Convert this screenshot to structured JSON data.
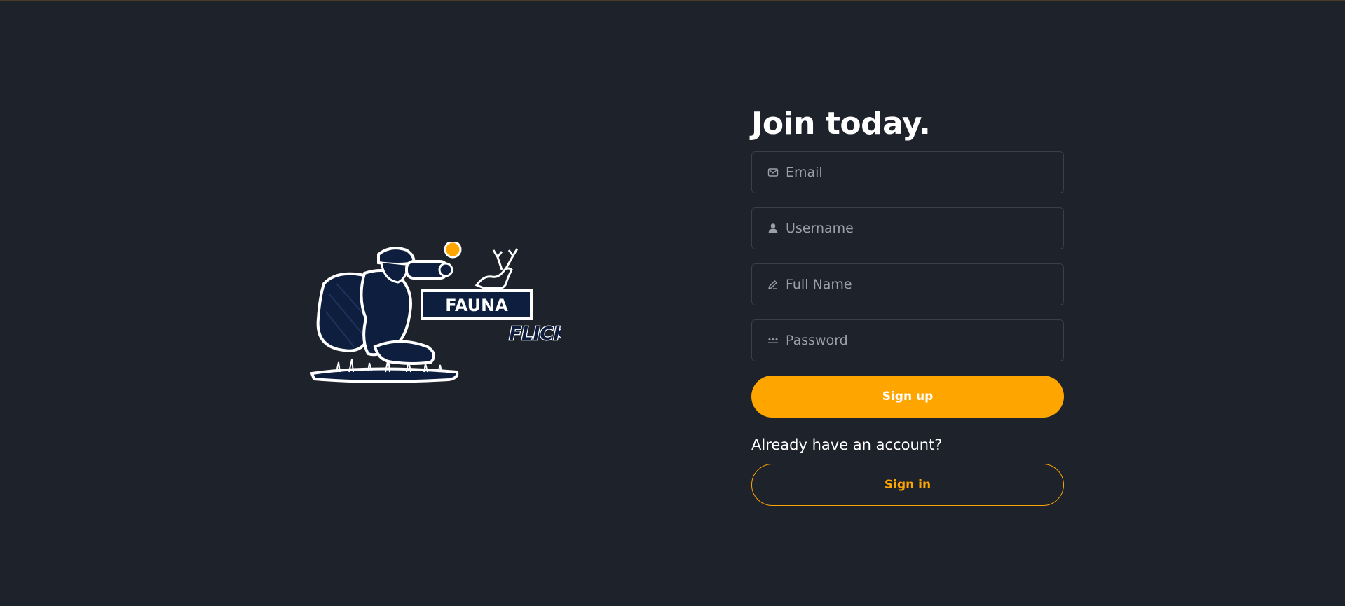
{
  "brand": {
    "logo_word_1": "FAUNA",
    "logo_word_2": "FLICK",
    "logo_icon": "photographer-deer-logo-icon",
    "accent_color": "#ffa500",
    "logo_navy": "#0e1e3f"
  },
  "signup": {
    "title": "Join today.",
    "fields": [
      {
        "icon": "mail-icon",
        "placeholder": "Email",
        "value": ""
      },
      {
        "icon": "user-icon",
        "placeholder": "Username",
        "value": ""
      },
      {
        "icon": "pen-icon",
        "placeholder": "Full Name",
        "value": ""
      },
      {
        "icon": "password-dots-icon",
        "placeholder": "Password",
        "value": ""
      }
    ],
    "submit_label": "Sign up",
    "already_text": "Already have an account?",
    "signin_label": "Sign in"
  },
  "colors": {
    "background": "#1e222a",
    "input_border": "#3a404b",
    "placeholder": "#9aa1ac"
  }
}
